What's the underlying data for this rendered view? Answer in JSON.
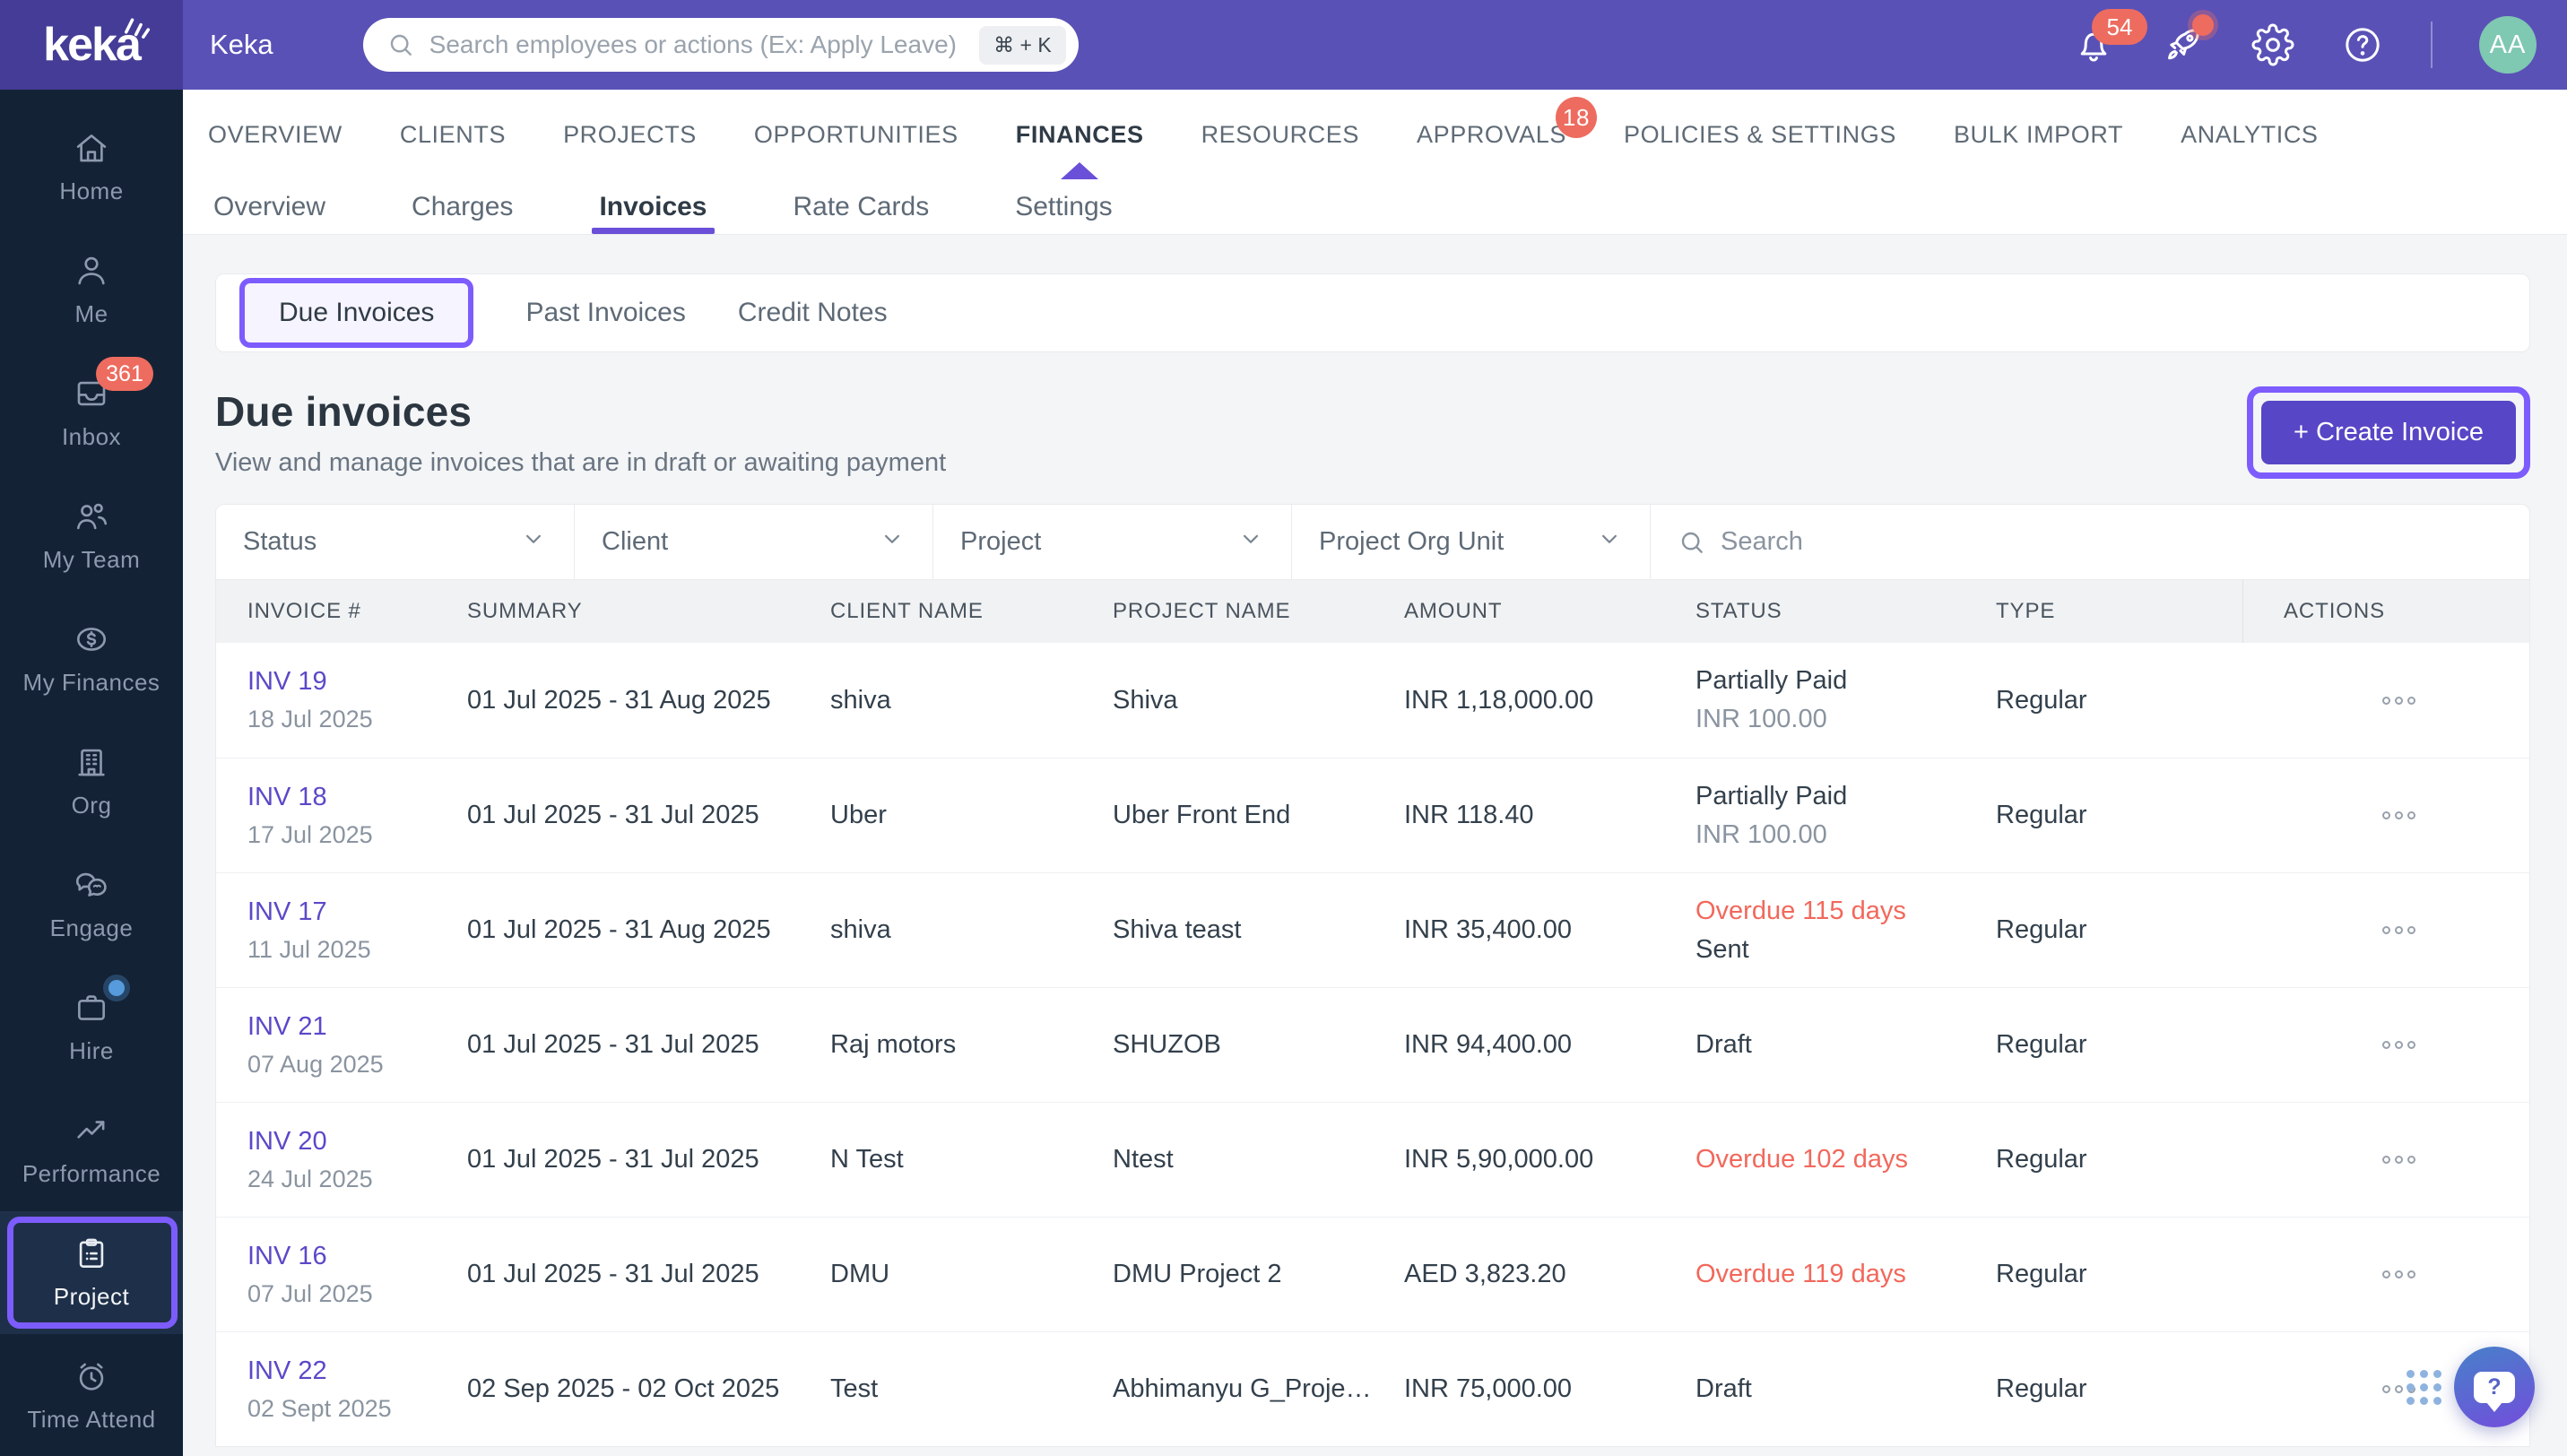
{
  "header": {
    "brand": "keka",
    "app_title": "Keka",
    "search": {
      "placeholder": "Search employees or actions (Ex: Apply Leave)",
      "shortcut": "⌘ + K"
    },
    "notification_count": "54",
    "avatar_initials": "AA",
    "icons": [
      "bell-icon",
      "rocket-icon",
      "gear-icon",
      "help-icon"
    ]
  },
  "main_nav": {
    "items": [
      {
        "label": "OVERVIEW"
      },
      {
        "label": "CLIENTS"
      },
      {
        "label": "PROJECTS"
      },
      {
        "label": "OPPORTUNITIES"
      },
      {
        "label": "FINANCES",
        "active": true
      },
      {
        "label": "RESOURCES"
      },
      {
        "label": "APPROVALS",
        "badge": "18"
      },
      {
        "label": "POLICIES & SETTINGS"
      },
      {
        "label": "BULK IMPORT"
      },
      {
        "label": "ANALYTICS"
      }
    ]
  },
  "sub_nav": {
    "items": [
      {
        "label": "Overview"
      },
      {
        "label": "Charges"
      },
      {
        "label": "Invoices",
        "active": true
      },
      {
        "label": "Rate Cards"
      },
      {
        "label": "Settings"
      }
    ]
  },
  "invoice_tabs": {
    "items": [
      {
        "label": "Due Invoices",
        "active": true
      },
      {
        "label": "Past Invoices"
      },
      {
        "label": "Credit Notes"
      }
    ]
  },
  "page": {
    "title": "Due invoices",
    "subtitle": "View and manage invoices that are in draft or awaiting payment",
    "create_button": "+ Create Invoice"
  },
  "filters": {
    "dropdowns": [
      {
        "label": "Status"
      },
      {
        "label": "Client"
      },
      {
        "label": "Project"
      },
      {
        "label": "Project Org Unit"
      }
    ],
    "search_placeholder": "Search"
  },
  "table": {
    "columns": [
      "INVOICE #",
      "SUMMARY",
      "CLIENT NAME",
      "PROJECT NAME",
      "AMOUNT",
      "STATUS",
      "TYPE",
      "ACTIONS"
    ],
    "rows": [
      {
        "invoice": "INV 19",
        "date": "18 Jul 2025",
        "summary": "01 Jul 2025 - 31 Aug 2025",
        "client": "shiva",
        "project": "Shiva",
        "amount": "INR 1,18,000.00",
        "status": "Partially Paid",
        "status_color": "default",
        "status_sub": "INR 100.00",
        "status_sub_color": "muted",
        "type": "Regular"
      },
      {
        "invoice": "INV 18",
        "date": "17 Jul 2025",
        "summary": "01 Jul 2025 - 31 Jul 2025",
        "client": "Uber",
        "project": "Uber Front End",
        "amount": "INR 118.40",
        "status": "Partially Paid",
        "status_color": "default",
        "status_sub": "INR 100.00",
        "status_sub_color": "muted",
        "type": "Regular"
      },
      {
        "invoice": "INV 17",
        "date": "11 Jul 2025",
        "summary": "01 Jul 2025 - 31 Aug 2025",
        "client": "shiva",
        "project": "Shiva teast",
        "amount": "INR 35,400.00",
        "status": "Overdue 115 days",
        "status_color": "overdue",
        "status_sub": "Sent",
        "status_sub_color": "default",
        "type": "Regular"
      },
      {
        "invoice": "INV 21",
        "date": "07 Aug 2025",
        "summary": "01 Jul 2025 - 31 Jul 2025",
        "client": "Raj motors",
        "project": "SHUZOB",
        "amount": "INR 94,400.00",
        "status": "Draft",
        "status_color": "default",
        "status_sub": "",
        "status_sub_color": "default",
        "type": "Regular"
      },
      {
        "invoice": "INV 20",
        "date": "24 Jul 2025",
        "summary": "01 Jul 2025 - 31 Jul 2025",
        "client": "N Test",
        "project": "Ntest",
        "amount": "INR 5,90,000.00",
        "status": "Overdue 102 days",
        "status_color": "overdue",
        "status_sub": "",
        "status_sub_color": "default",
        "type": "Regular"
      },
      {
        "invoice": "INV 16",
        "date": "07 Jul 2025",
        "summary": "01 Jul 2025 - 31 Jul 2025",
        "client": "DMU",
        "project": "DMU Project 2",
        "amount": "AED 3,823.20",
        "status": "Overdue 119 days",
        "status_color": "overdue",
        "status_sub": "",
        "status_sub_color": "default",
        "type": "Regular"
      },
      {
        "invoice": "INV 22",
        "date": "02 Sept 2025",
        "summary": "02 Sep 2025 - 02 Oct 2025",
        "client": "Test",
        "project": "Abhimanyu G_Proje…",
        "amount": "INR 75,000.00",
        "status": "Draft",
        "status_color": "default",
        "status_sub": "",
        "status_sub_color": "default",
        "type": "Regular"
      }
    ]
  },
  "sidebar": {
    "items": [
      {
        "label": "Home",
        "icon": "home-icon"
      },
      {
        "label": "Me",
        "icon": "person-icon"
      },
      {
        "label": "Inbox",
        "icon": "inbox-icon",
        "badge": "361"
      },
      {
        "label": "My Team",
        "icon": "team-icon"
      },
      {
        "label": "My Finances",
        "icon": "finances-icon"
      },
      {
        "label": "Org",
        "icon": "org-icon"
      },
      {
        "label": "Engage",
        "icon": "engage-icon"
      },
      {
        "label": "Hire",
        "icon": "hire-icon",
        "dot": true
      },
      {
        "label": "Performance",
        "icon": "performance-icon"
      },
      {
        "label": "Project",
        "icon": "project-icon",
        "active": true
      },
      {
        "label": "Time Attend",
        "icon": "time-attend-icon"
      }
    ]
  },
  "colors": {
    "header_purple": "#5A51B7",
    "logo_block_purple": "#443C96",
    "sidebar_navy": "#142236",
    "accent_purple": "#6A4FD8",
    "highlight_purple": "#7D5CFD",
    "button_purple": "#5746C6",
    "link_purple": "#5A49C8",
    "overdue_red": "#F2685C",
    "badge_red": "#ED6C5F",
    "avatar_teal": "#7FC8B2"
  }
}
